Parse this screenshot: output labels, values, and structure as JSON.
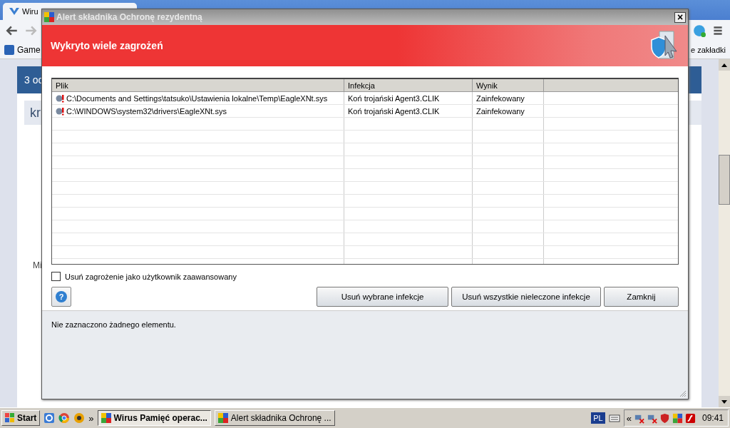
{
  "browser": {
    "tab_title": "Wiru",
    "bookmark": "Game",
    "bookmark_right": "e zakładki",
    "page": {
      "header": "3 oc",
      "panel": "kr",
      "label": "Mi"
    }
  },
  "dialog": {
    "title": "Alert składnika Ochronę rezydentną",
    "close": "×",
    "heading": "Wykryto wiele zagrożeń",
    "columns": [
      "Plik",
      "Infekcja",
      "Wynik"
    ],
    "rows": [
      {
        "file": "C:\\Documents and Settings\\tatsuko\\Ustawienia lokalne\\Temp\\EagleXNt.sys",
        "infection": "Koń trojański Agent3.CLIK",
        "result": "Zainfekowany"
      },
      {
        "file": "C:\\WINDOWS\\system32\\drivers\\EagleXNt.sys",
        "infection": "Koń trojański Agent3.CLIK",
        "result": "Zainfekowany"
      }
    ],
    "advanced": {
      "label": "Usuń zagrożenie jako użytkownik zaawansowany",
      "checked": false
    },
    "help": "?",
    "buttons": [
      "Usuń wybrane infekcje",
      "Usuń wszystkie nieleczone infekcje",
      "Zamknij"
    ],
    "status": "Nie zaznaczono żadnego elementu."
  },
  "taskbar": {
    "start": "Start",
    "more": "»",
    "tasks": [
      {
        "label": "Wirus Pamięć operac...",
        "selected": true
      },
      {
        "label": "Alert składnika Ochronę ...",
        "selected": false
      }
    ],
    "language": "PL",
    "tray_toggle": "«",
    "clock": "09:41"
  }
}
